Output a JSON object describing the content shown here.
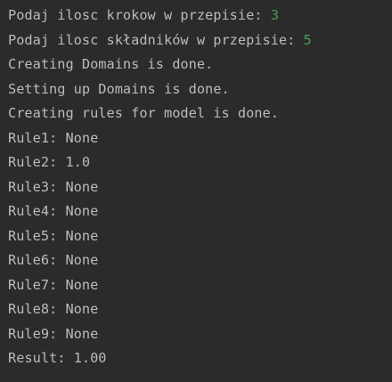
{
  "console": {
    "prompts": [
      {
        "text": "Podaj ilosc krokow w przepisie: ",
        "input": "3"
      },
      {
        "text": "Podaj ilosc składników w przepisie: ",
        "input": "5"
      }
    ],
    "lines": [
      "Creating Domains is done.",
      "Setting up Domains is done.",
      "Creating rules for model is done.",
      "Rule1: None",
      "Rule2: 1.0",
      "Rule3: None",
      "Rule4: None",
      "Rule5: None",
      "Rule6: None",
      "Rule7: None",
      "Rule8: None",
      "Rule9: None",
      "Result: 1.00"
    ],
    "colors": {
      "background": "#2b2b2b",
      "text": "#bbbbbb",
      "user_input": "#499c54"
    }
  }
}
